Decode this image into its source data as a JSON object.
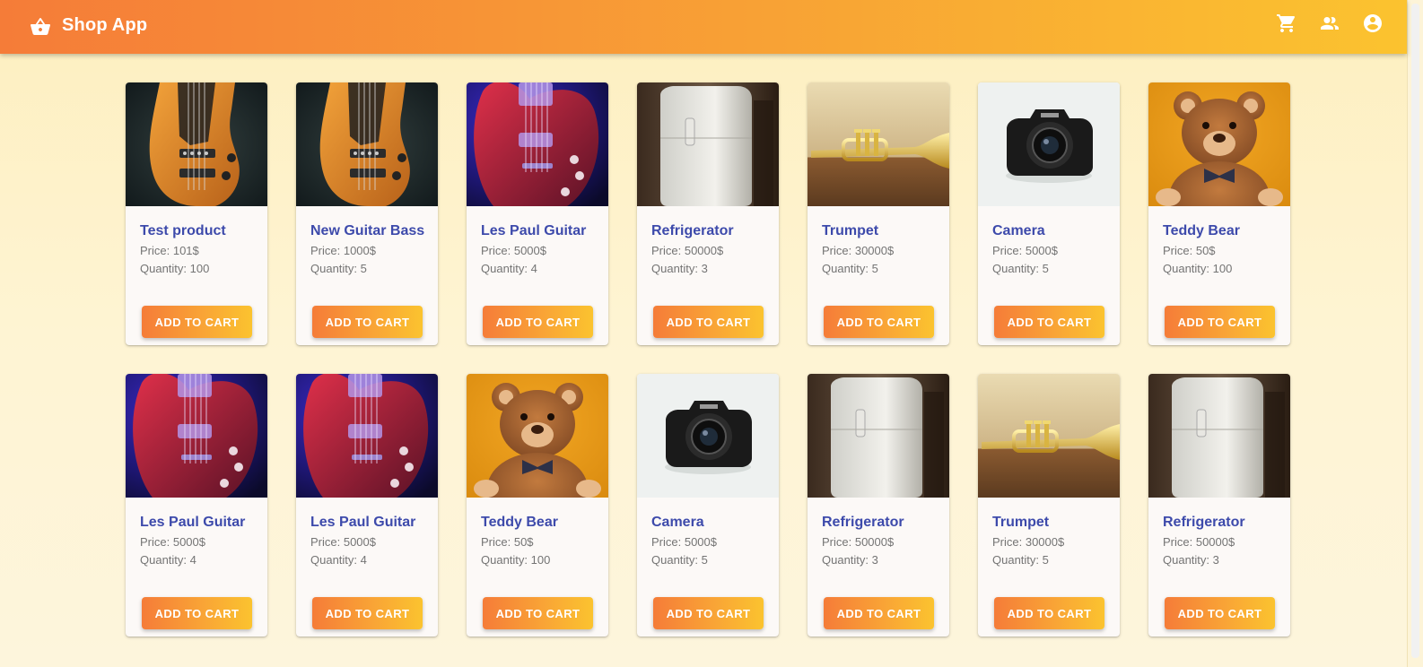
{
  "app": {
    "title": "Shop App"
  },
  "icons": {
    "brand": "shopping-basket-icon",
    "cart": "shopping-cart-icon",
    "users": "people-icon",
    "account": "account-circle-icon"
  },
  "colors": {
    "accent_start": "#f57c38",
    "accent_end": "#fbc32f",
    "title_color": "#3d4aab"
  },
  "products": [
    {
      "name": "Test product",
      "price": "Price: 101$",
      "quantity": "Quantity: 100",
      "button": "ADD TO CART",
      "image": "bass-guitar"
    },
    {
      "name": "New Guitar Bass",
      "price": "Price: 1000$",
      "quantity": "Quantity: 5",
      "button": "ADD TO CART",
      "image": "bass-guitar"
    },
    {
      "name": "Les Paul Guitar",
      "price": "Price: 5000$",
      "quantity": "Quantity: 4",
      "button": "ADD TO CART",
      "image": "les-paul"
    },
    {
      "name": "Refrigerator",
      "price": "Price: 50000$",
      "quantity": "Quantity: 3",
      "button": "ADD TO CART",
      "image": "fridge"
    },
    {
      "name": "Trumpet",
      "price": "Price: 30000$",
      "quantity": "Quantity: 5",
      "button": "ADD TO CART",
      "image": "trumpet"
    },
    {
      "name": "Camera",
      "price": "Price: 5000$",
      "quantity": "Quantity: 5",
      "button": "ADD TO CART",
      "image": "camera"
    },
    {
      "name": "Teddy Bear",
      "price": "Price: 50$",
      "quantity": "Quantity: 100",
      "button": "ADD TO CART",
      "image": "teddy"
    },
    {
      "name": "Les Paul Guitar",
      "price": "Price: 5000$",
      "quantity": "Quantity: 4",
      "button": "ADD TO CART",
      "image": "les-paul"
    },
    {
      "name": "Les Paul Guitar",
      "price": "Price: 5000$",
      "quantity": "Quantity: 4",
      "button": "ADD TO CART",
      "image": "les-paul"
    },
    {
      "name": "Teddy Bear",
      "price": "Price: 50$",
      "quantity": "Quantity: 100",
      "button": "ADD TO CART",
      "image": "teddy"
    },
    {
      "name": "Camera",
      "price": "Price: 5000$",
      "quantity": "Quantity: 5",
      "button": "ADD TO CART",
      "image": "camera"
    },
    {
      "name": "Refrigerator",
      "price": "Price: 50000$",
      "quantity": "Quantity: 3",
      "button": "ADD TO CART",
      "image": "fridge"
    },
    {
      "name": "Trumpet",
      "price": "Price: 30000$",
      "quantity": "Quantity: 5",
      "button": "ADD TO CART",
      "image": "trumpet"
    },
    {
      "name": "Refrigerator",
      "price": "Price: 50000$",
      "quantity": "Quantity: 3",
      "button": "ADD TO CART",
      "image": "fridge"
    }
  ]
}
